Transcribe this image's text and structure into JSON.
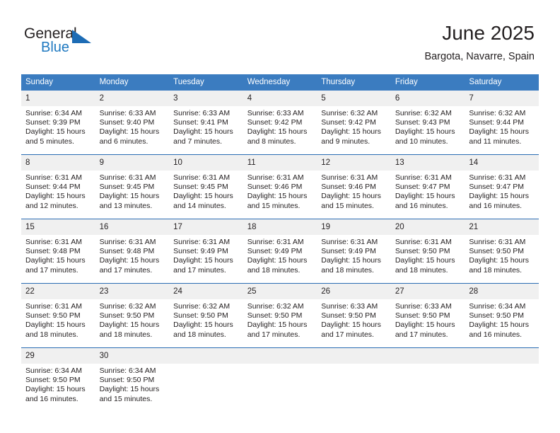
{
  "brand": {
    "name_top": "General",
    "name_bottom": "Blue",
    "accent_color": "#1f79c0",
    "triangle_color": "#1d6cb5",
    "text_color": "#231f20"
  },
  "header": {
    "title": "June 2025",
    "subtitle": "Bargota, Navarre, Spain"
  },
  "theme": {
    "header_blue": "#3b7cc0",
    "row_divider_blue": "#2a6cb3",
    "daynum_background": "#f0f0f0"
  },
  "weekdays": [
    "Sunday",
    "Monday",
    "Tuesday",
    "Wednesday",
    "Thursday",
    "Friday",
    "Saturday"
  ],
  "weeks": [
    [
      {
        "day": "1",
        "sunrise": "Sunrise: 6:34 AM",
        "sunset": "Sunset: 9:39 PM",
        "daylight": "Daylight: 15 hours and 5 minutes."
      },
      {
        "day": "2",
        "sunrise": "Sunrise: 6:33 AM",
        "sunset": "Sunset: 9:40 PM",
        "daylight": "Daylight: 15 hours and 6 minutes."
      },
      {
        "day": "3",
        "sunrise": "Sunrise: 6:33 AM",
        "sunset": "Sunset: 9:41 PM",
        "daylight": "Daylight: 15 hours and 7 minutes."
      },
      {
        "day": "4",
        "sunrise": "Sunrise: 6:33 AM",
        "sunset": "Sunset: 9:42 PM",
        "daylight": "Daylight: 15 hours and 8 minutes."
      },
      {
        "day": "5",
        "sunrise": "Sunrise: 6:32 AM",
        "sunset": "Sunset: 9:42 PM",
        "daylight": "Daylight: 15 hours and 9 minutes."
      },
      {
        "day": "6",
        "sunrise": "Sunrise: 6:32 AM",
        "sunset": "Sunset: 9:43 PM",
        "daylight": "Daylight: 15 hours and 10 minutes."
      },
      {
        "day": "7",
        "sunrise": "Sunrise: 6:32 AM",
        "sunset": "Sunset: 9:44 PM",
        "daylight": "Daylight: 15 hours and 11 minutes."
      }
    ],
    [
      {
        "day": "8",
        "sunrise": "Sunrise: 6:31 AM",
        "sunset": "Sunset: 9:44 PM",
        "daylight": "Daylight: 15 hours and 12 minutes."
      },
      {
        "day": "9",
        "sunrise": "Sunrise: 6:31 AM",
        "sunset": "Sunset: 9:45 PM",
        "daylight": "Daylight: 15 hours and 13 minutes."
      },
      {
        "day": "10",
        "sunrise": "Sunrise: 6:31 AM",
        "sunset": "Sunset: 9:45 PM",
        "daylight": "Daylight: 15 hours and 14 minutes."
      },
      {
        "day": "11",
        "sunrise": "Sunrise: 6:31 AM",
        "sunset": "Sunset: 9:46 PM",
        "daylight": "Daylight: 15 hours and 15 minutes."
      },
      {
        "day": "12",
        "sunrise": "Sunrise: 6:31 AM",
        "sunset": "Sunset: 9:46 PM",
        "daylight": "Daylight: 15 hours and 15 minutes."
      },
      {
        "day": "13",
        "sunrise": "Sunrise: 6:31 AM",
        "sunset": "Sunset: 9:47 PM",
        "daylight": "Daylight: 15 hours and 16 minutes."
      },
      {
        "day": "14",
        "sunrise": "Sunrise: 6:31 AM",
        "sunset": "Sunset: 9:47 PM",
        "daylight": "Daylight: 15 hours and 16 minutes."
      }
    ],
    [
      {
        "day": "15",
        "sunrise": "Sunrise: 6:31 AM",
        "sunset": "Sunset: 9:48 PM",
        "daylight": "Daylight: 15 hours and 17 minutes."
      },
      {
        "day": "16",
        "sunrise": "Sunrise: 6:31 AM",
        "sunset": "Sunset: 9:48 PM",
        "daylight": "Daylight: 15 hours and 17 minutes."
      },
      {
        "day": "17",
        "sunrise": "Sunrise: 6:31 AM",
        "sunset": "Sunset: 9:49 PM",
        "daylight": "Daylight: 15 hours and 17 minutes."
      },
      {
        "day": "18",
        "sunrise": "Sunrise: 6:31 AM",
        "sunset": "Sunset: 9:49 PM",
        "daylight": "Daylight: 15 hours and 18 minutes."
      },
      {
        "day": "19",
        "sunrise": "Sunrise: 6:31 AM",
        "sunset": "Sunset: 9:49 PM",
        "daylight": "Daylight: 15 hours and 18 minutes."
      },
      {
        "day": "20",
        "sunrise": "Sunrise: 6:31 AM",
        "sunset": "Sunset: 9:50 PM",
        "daylight": "Daylight: 15 hours and 18 minutes."
      },
      {
        "day": "21",
        "sunrise": "Sunrise: 6:31 AM",
        "sunset": "Sunset: 9:50 PM",
        "daylight": "Daylight: 15 hours and 18 minutes."
      }
    ],
    [
      {
        "day": "22",
        "sunrise": "Sunrise: 6:31 AM",
        "sunset": "Sunset: 9:50 PM",
        "daylight": "Daylight: 15 hours and 18 minutes."
      },
      {
        "day": "23",
        "sunrise": "Sunrise: 6:32 AM",
        "sunset": "Sunset: 9:50 PM",
        "daylight": "Daylight: 15 hours and 18 minutes."
      },
      {
        "day": "24",
        "sunrise": "Sunrise: 6:32 AM",
        "sunset": "Sunset: 9:50 PM",
        "daylight": "Daylight: 15 hours and 18 minutes."
      },
      {
        "day": "25",
        "sunrise": "Sunrise: 6:32 AM",
        "sunset": "Sunset: 9:50 PM",
        "daylight": "Daylight: 15 hours and 17 minutes."
      },
      {
        "day": "26",
        "sunrise": "Sunrise: 6:33 AM",
        "sunset": "Sunset: 9:50 PM",
        "daylight": "Daylight: 15 hours and 17 minutes."
      },
      {
        "day": "27",
        "sunrise": "Sunrise: 6:33 AM",
        "sunset": "Sunset: 9:50 PM",
        "daylight": "Daylight: 15 hours and 17 minutes."
      },
      {
        "day": "28",
        "sunrise": "Sunrise: 6:34 AM",
        "sunset": "Sunset: 9:50 PM",
        "daylight": "Daylight: 15 hours and 16 minutes."
      }
    ],
    [
      {
        "day": "29",
        "sunrise": "Sunrise: 6:34 AM",
        "sunset": "Sunset: 9:50 PM",
        "daylight": "Daylight: 15 hours and 16 minutes."
      },
      {
        "day": "30",
        "sunrise": "Sunrise: 6:34 AM",
        "sunset": "Sunset: 9:50 PM",
        "daylight": "Daylight: 15 hours and 15 minutes."
      },
      {
        "day": "",
        "sunrise": "",
        "sunset": "",
        "daylight": ""
      },
      {
        "day": "",
        "sunrise": "",
        "sunset": "",
        "daylight": ""
      },
      {
        "day": "",
        "sunrise": "",
        "sunset": "",
        "daylight": ""
      },
      {
        "day": "",
        "sunrise": "",
        "sunset": "",
        "daylight": ""
      },
      {
        "day": "",
        "sunrise": "",
        "sunset": "",
        "daylight": ""
      }
    ]
  ]
}
